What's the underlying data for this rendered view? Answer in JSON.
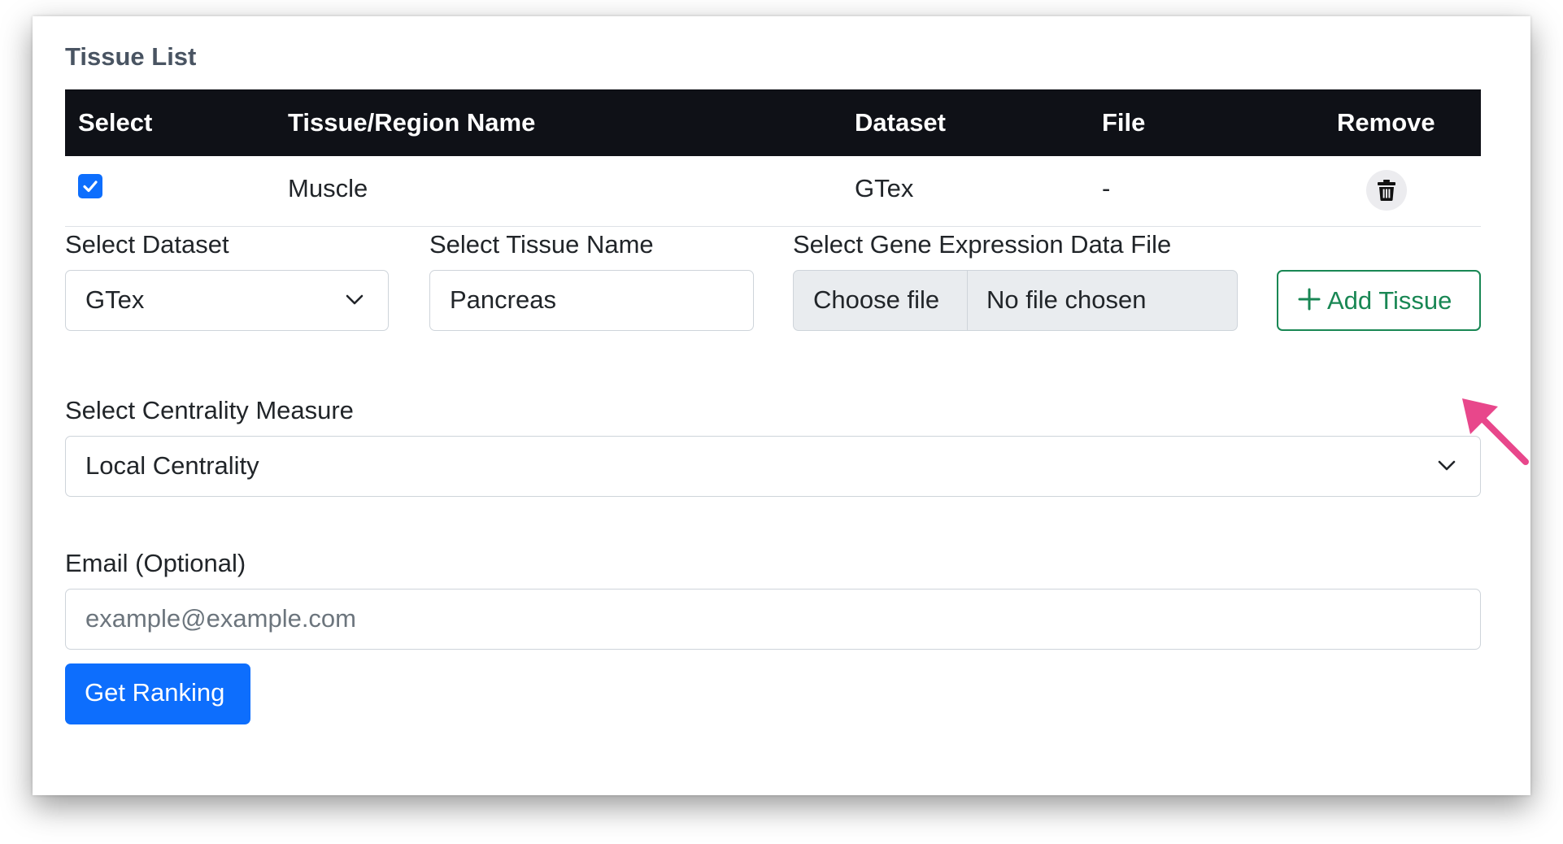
{
  "tissue_list": {
    "title": "Tissue List",
    "columns": [
      "Select",
      "Tissue/Region Name",
      "Dataset",
      "File",
      "Remove"
    ],
    "rows": [
      {
        "selected": true,
        "name": "Muscle",
        "dataset": "GTex",
        "file": "-"
      }
    ]
  },
  "form": {
    "dataset_label": "Select Dataset",
    "dataset_value": "GTex",
    "tissue_label": "Select Tissue Name",
    "tissue_value": "Pancreas",
    "file_label": "Select Gene Expression Data File",
    "file_button": "Choose file",
    "file_status": "No file chosen",
    "add_button": "Add Tissue",
    "centrality_label": "Select Centrality Measure",
    "centrality_value": "Local Centrality",
    "email_label": "Email (Optional)",
    "email_placeholder": "example@example.com",
    "submit_button": "Get Ranking"
  },
  "colors": {
    "primary": "#0d6efd",
    "success": "#198754",
    "table_header": "#0f1117",
    "annotation_arrow": "#e8478b"
  }
}
